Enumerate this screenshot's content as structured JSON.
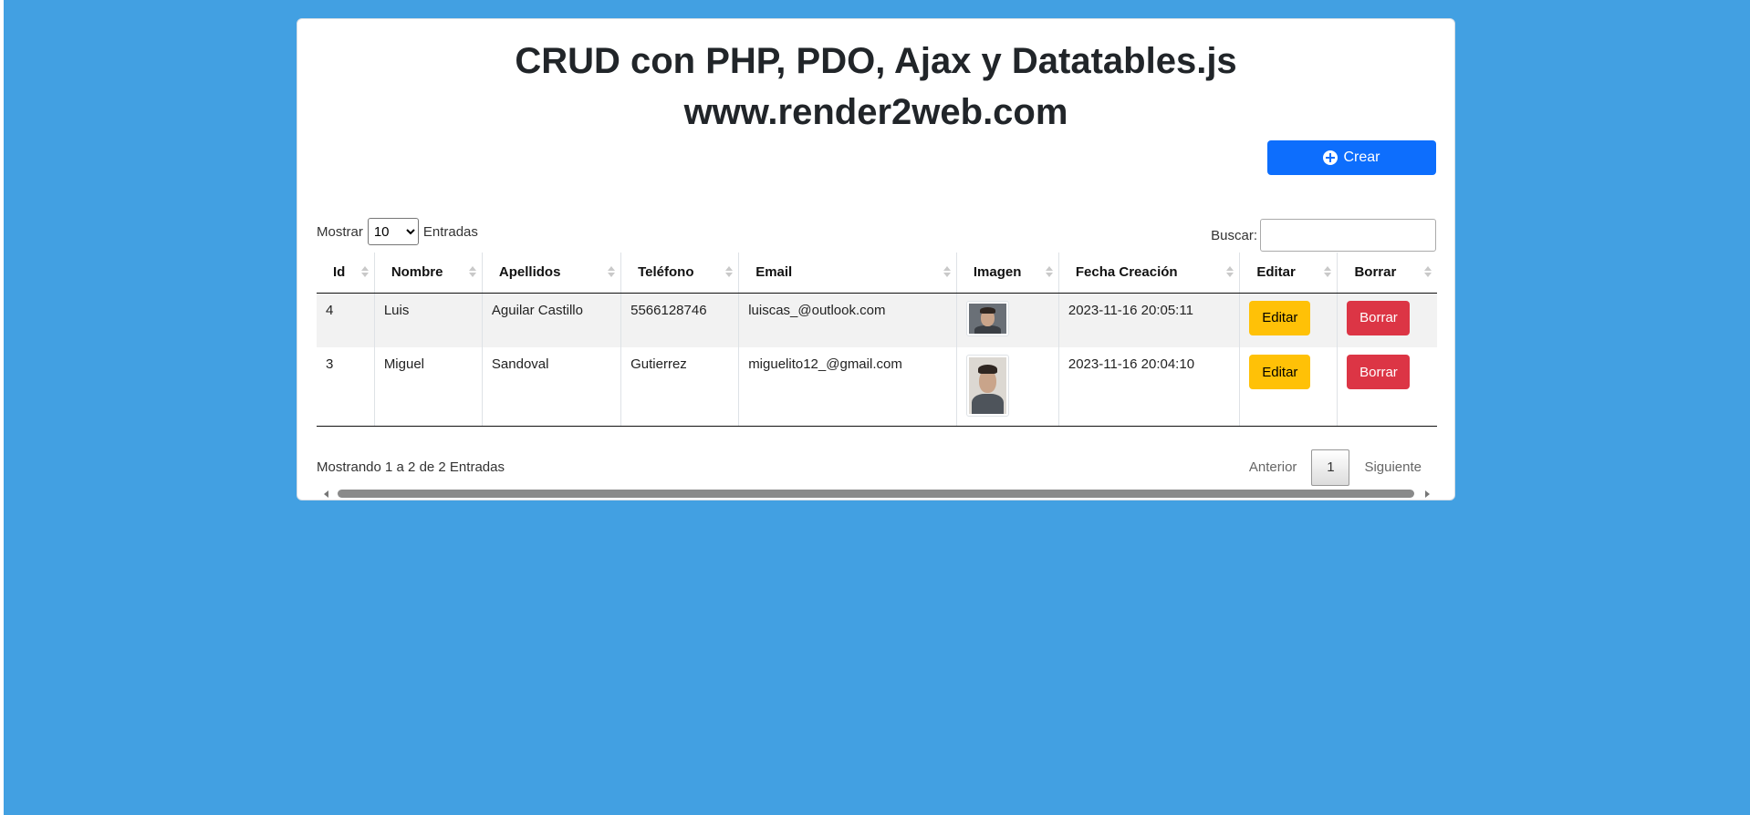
{
  "header": {
    "title": "CRUD con PHP, PDO, Ajax y Datatables.js",
    "subtitle": "www.render2web.com"
  },
  "toolbar": {
    "create_label": "Crear",
    "create_icon": "plus-circle-icon"
  },
  "controls": {
    "show_label": "Mostrar",
    "page_length": "10",
    "entries_label": "Entradas",
    "search_label": "Buscar:",
    "search_value": ""
  },
  "table": {
    "columns": [
      "Id",
      "Nombre",
      "Apellidos",
      "Teléfono",
      "Email",
      "Imagen",
      "Fecha Creación",
      "Editar",
      "Borrar"
    ],
    "rows": [
      {
        "id": "4",
        "nombre": "Luis",
        "apellidos": "Aguilar Castillo",
        "telefono": "5566128746",
        "email": "luiscas_@outlook.com",
        "fecha": "2023-11-16 20:05:11",
        "edit_label": "Editar",
        "delete_label": "Borrar"
      },
      {
        "id": "3",
        "nombre": "Miguel",
        "apellidos": "Sandoval",
        "telefono": "Gutierrez",
        "email": "miguelito12_@gmail.com",
        "fecha": "2023-11-16 20:04:10",
        "edit_label": "Editar",
        "delete_label": "Borrar"
      }
    ]
  },
  "footer": {
    "info": "Mostrando 1 a 2 de 2 Entradas",
    "prev_label": "Anterior",
    "current_page": "1",
    "next_label": "Siguiente"
  },
  "colors": {
    "background": "#42a0e2",
    "primary": "#0d6efd",
    "warning": "#ffc107",
    "danger": "#dc3545"
  }
}
